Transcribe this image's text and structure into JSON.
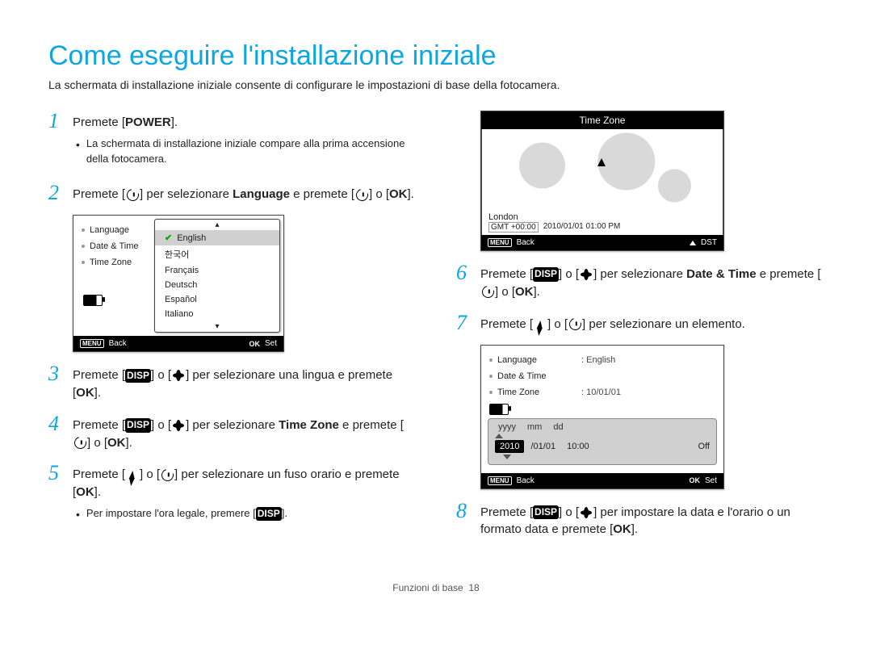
{
  "title": "Come eseguire l'installazione iniziale",
  "intro": "La schermata di installazione iniziale consente di configurare le impostazioni di base della fotocamera.",
  "steps": {
    "s1": {
      "pre": "Premete [",
      "power": "POWER",
      "post": "].",
      "bullet": "La schermata di installazione iniziale compare alla prima accensione della fotocamera."
    },
    "s2": {
      "a": "Premete [",
      "b": "] per selezionare ",
      "lang": "Language",
      "c": " e premete [",
      "d": "] o [",
      "ok": "OK",
      "e": "]."
    },
    "s3": {
      "a": "Premete [",
      "disp": "DISP",
      "b": "] o [",
      "c": "] per selezionare una lingua e premete [",
      "ok": "OK",
      "d": "]."
    },
    "s4": {
      "a": "Premete [",
      "disp": "DISP",
      "b": "] o [",
      "c": "] per selezionare ",
      "tz": "Time Zone",
      "d": " e premete [",
      "e": "] o [",
      "ok": "OK",
      "f": "]."
    },
    "s5": {
      "a": "Premete [",
      "b": "] o [",
      "c": "] per selezionare un fuso orario e premete [",
      "ok": "OK",
      "d": "].",
      "bullet_a": "Per impostare l'ora legale, premere [",
      "bullet_disp": "DISP",
      "bullet_b": "]."
    },
    "s6": {
      "a": "Premete [",
      "disp": "DISP",
      "b": "] o [",
      "c": "] per selezionare ",
      "dt": "Date & Time",
      "d": " e premete [",
      "e": "] o [",
      "ok": "OK",
      "f": "]."
    },
    "s7": {
      "a": "Premete [",
      "b": "] o [",
      "c": "] per selezionare un elemento."
    },
    "s8": {
      "a": "Premete [",
      "disp": "DISP",
      "b": "] o [",
      "c": "] per impostare la data e l'orario o un formato data e premete [",
      "ok": "OK",
      "d": "]."
    }
  },
  "lcd_lang": {
    "menu": {
      "language": "Language",
      "datetime": "Date & Time",
      "timezone": "Time Zone"
    },
    "items": [
      "English",
      "한국어",
      "Français",
      "Deutsch",
      "Español",
      "Italiano"
    ],
    "back": "Back",
    "set": "Set"
  },
  "lcd_map": {
    "title": "Time Zone",
    "city": "London",
    "gmt": "GMT +00:00",
    "dt": "2010/01/01 01:00 PM",
    "back": "Back",
    "dst": "DST"
  },
  "lcd_dt": {
    "menu": {
      "language": "Language",
      "datetime": "Date & Time",
      "timezone": "Time Zone"
    },
    "vals": {
      "language": "English",
      "timezone": "10/01/01"
    },
    "head": {
      "y": "yyyy",
      "m": "mm",
      "d": "dd"
    },
    "row": {
      "year": "2010",
      "rest": "/01/01",
      "time": "10:00",
      "off": "Off"
    },
    "back": "Back",
    "set": "Set"
  },
  "footer": {
    "section": "Funzioni di base",
    "page": "18"
  }
}
